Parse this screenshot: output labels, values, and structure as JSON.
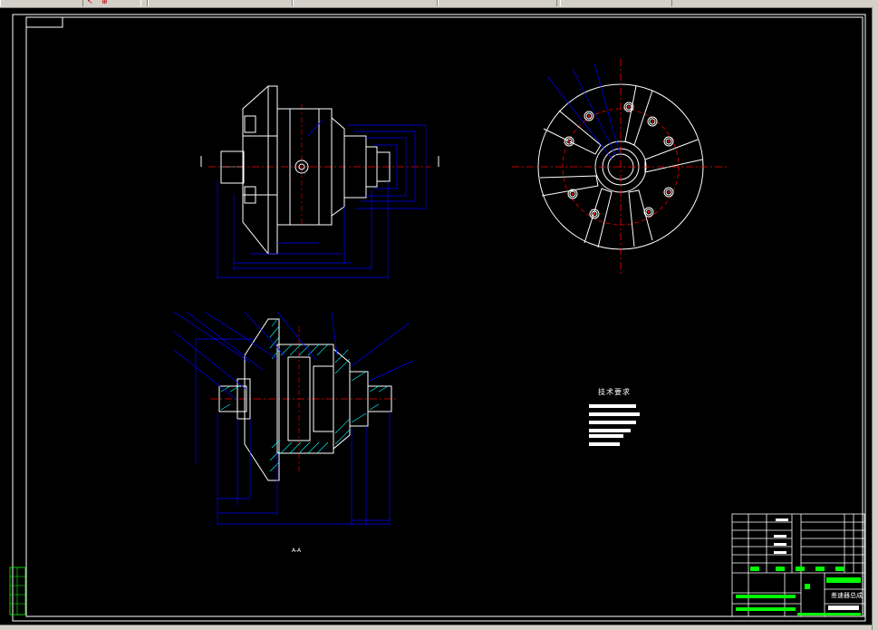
{
  "drawing": {
    "technical_requirements_title": "技术要求",
    "title_block_name": "差速器总成",
    "section_label": "A-A"
  },
  "colors": {
    "background": "#000000",
    "outline": "#ffffff",
    "dimension": "#0000ff",
    "centerline": "#ff0000",
    "hatch": "#00ffff",
    "titleblock_green": "#00ff00"
  },
  "icons": [
    "cursor-arrow-icon",
    "lock-icon"
  ]
}
